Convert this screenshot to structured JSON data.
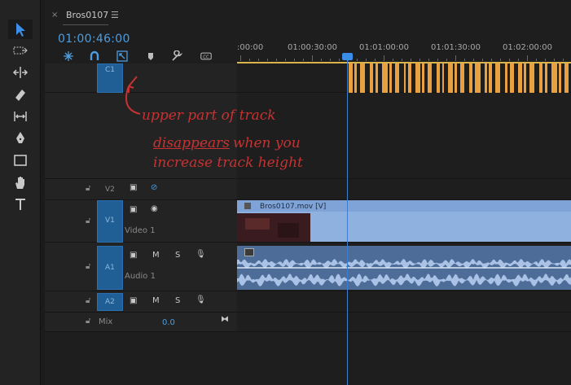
{
  "window": {
    "tab_title": "Bros0107",
    "tab_close": "×",
    "tab_menu": "☰"
  },
  "timecode": "01:00:46:00",
  "tools": [
    "selection-tool",
    "track-select-tool",
    "ripple-edit-tool",
    "razor-tool",
    "slip-tool",
    "pen-tool",
    "rectangle-tool",
    "hand-tool",
    "type-tool"
  ],
  "ruler": {
    "labels": [
      ":00:00",
      "01:00:30:00",
      "01:01:00:00",
      "01:01:30:00",
      "01:02:00:00"
    ]
  },
  "tracks": {
    "c1": {
      "label": "C1"
    },
    "v2": {
      "label": "V2"
    },
    "v1": {
      "label": "V1",
      "name": "Video 1"
    },
    "a1": {
      "label": "A1",
      "name": "Audio 1",
      "m": "M",
      "s": "S"
    },
    "a2": {
      "label": "A2",
      "m": "M",
      "s": "S"
    },
    "mix": {
      "label": "Mix",
      "value": "0.0"
    }
  },
  "clips": {
    "video_clip": "Bros0107.mov [V]"
  },
  "annotation": {
    "line1": "upper part of track",
    "line2a": "disappears",
    "line2b": " when you",
    "line3": "increase track height"
  },
  "colors": {
    "accent": "#4d9de0",
    "caption_marker": "#e8a040",
    "clip": "#8fb1e0",
    "annotation": "#c83232"
  }
}
